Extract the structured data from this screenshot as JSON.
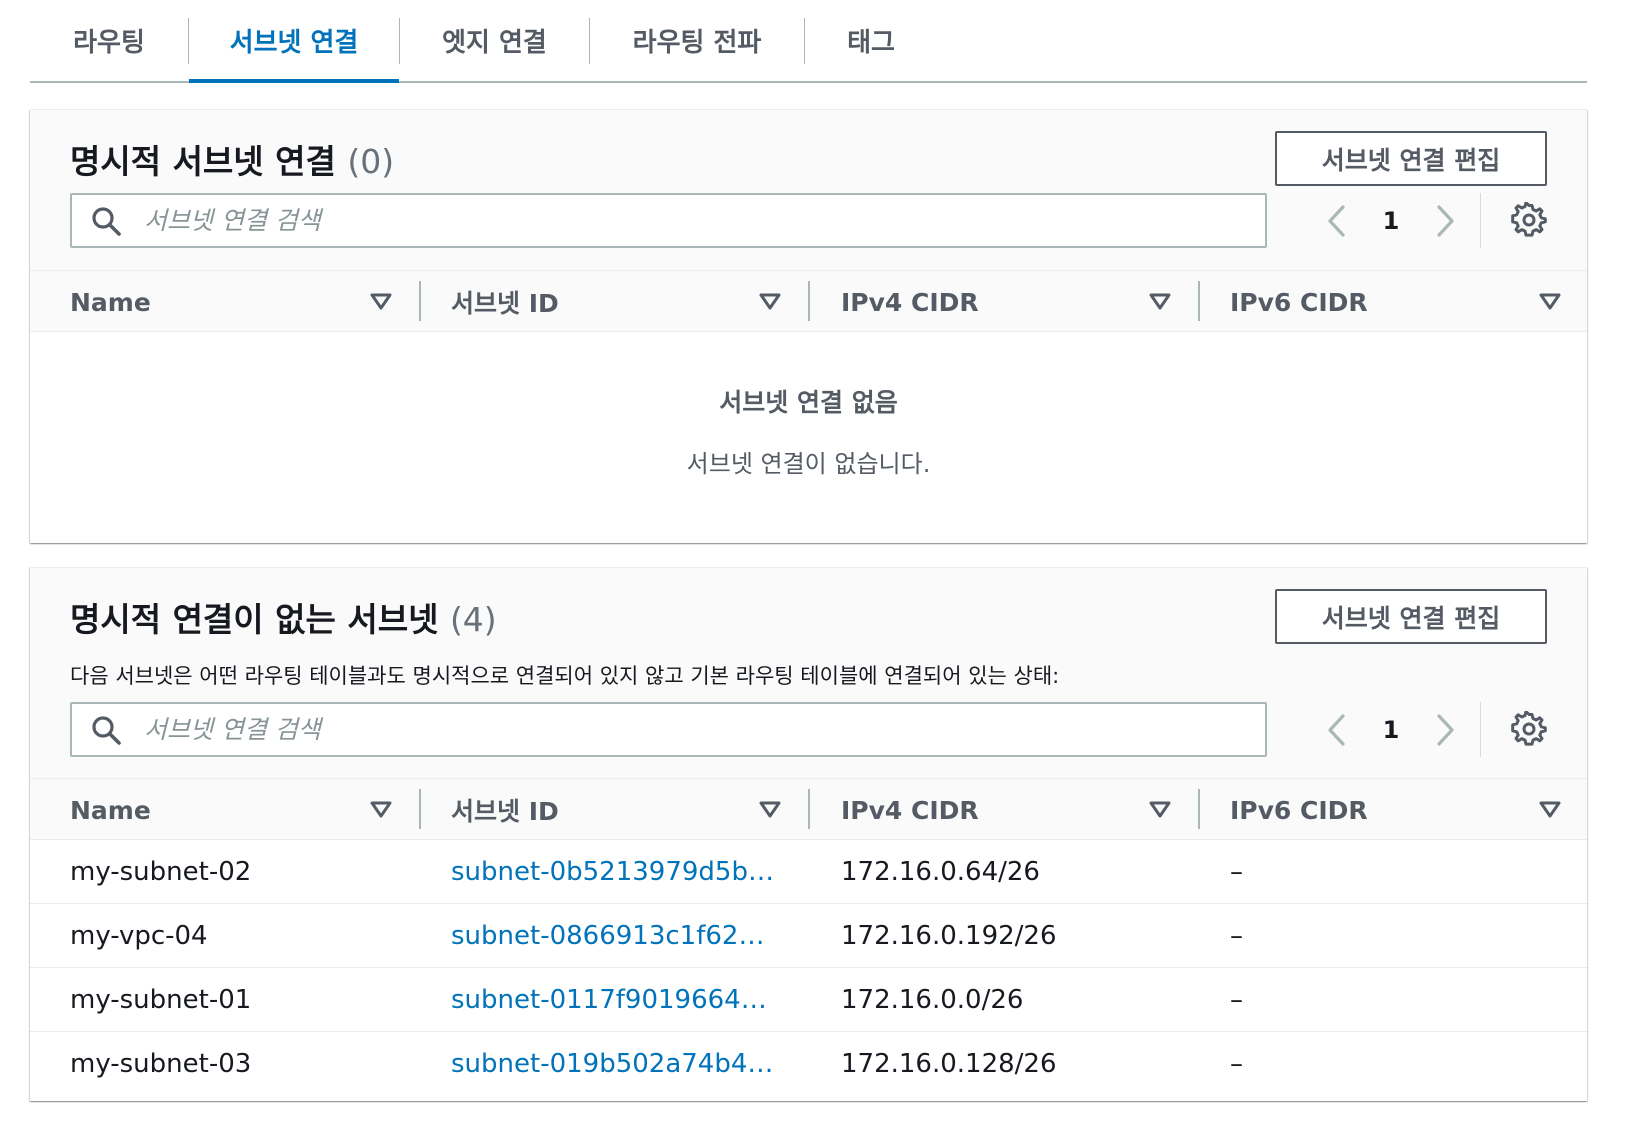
{
  "tabs": [
    {
      "label": "라우팅",
      "active": false
    },
    {
      "label": "서브넷 연결",
      "active": true
    },
    {
      "label": "엣지 연결",
      "active": false
    },
    {
      "label": "라우팅 전파",
      "active": false
    },
    {
      "label": "태그",
      "active": false
    }
  ],
  "explicit_panel": {
    "title": "명시적 서브넷 연결",
    "count": "(0)",
    "edit_button": "서브넷 연결 편집",
    "search_placeholder": "서브넷 연결 검색",
    "page": "1",
    "columns": [
      "Name",
      "서브넷 ID",
      "IPv4 CIDR",
      "IPv6 CIDR"
    ],
    "empty_title": "서브넷 연결 없음",
    "empty_desc": "서브넷 연결이 없습니다."
  },
  "implicit_panel": {
    "title": "명시적 연결이 없는 서브넷",
    "count": "(4)",
    "edit_button": "서브넷 연결 편집",
    "description": "다음 서브넷은 어떤 라우팅 테이블과도 명시적으로 연결되어 있지 않고 기본 라우팅 테이블에 연결되어 있는 상태:",
    "search_placeholder": "서브넷 연결 검색",
    "page": "1",
    "columns": [
      "Name",
      "서브넷 ID",
      "IPv4 CIDR",
      "IPv6 CIDR"
    ],
    "rows": [
      {
        "name": "my-subnet-02",
        "subnet_id": "subnet-0b5213979d5b…",
        "ipv4": "172.16.0.64/26",
        "ipv6": "–"
      },
      {
        "name": "my-vpc-04",
        "subnet_id": "subnet-0866913c1f62…",
        "ipv4": "172.16.0.192/26",
        "ipv6": "–"
      },
      {
        "name": "my-subnet-01",
        "subnet_id": "subnet-0117f9019664…",
        "ipv4": "172.16.0.0/26",
        "ipv6": "–"
      },
      {
        "name": "my-subnet-03",
        "subnet_id": "subnet-019b502a74b4…",
        "ipv4": "172.16.0.128/26",
        "ipv6": "–"
      }
    ]
  },
  "icons": {
    "search": "search-icon",
    "prev": "chevron-left-icon",
    "next": "chevron-right-icon",
    "settings": "gear-icon",
    "sort": "sort-caret-down-icon"
  },
  "colors": {
    "link": "#0073bb",
    "active_tab": "#0073bb",
    "text": "#16191f",
    "muted": "#545b64"
  }
}
